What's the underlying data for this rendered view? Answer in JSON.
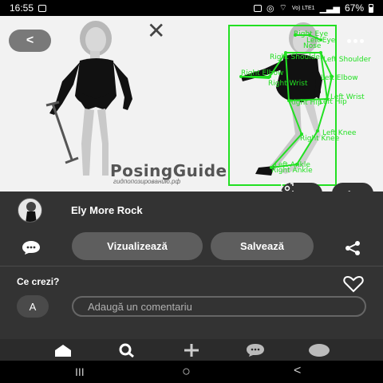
{
  "status_bar": {
    "time": "16:55",
    "network": "Vo) LTE1",
    "battery": "67%"
  },
  "pin_image": {
    "watermark": "PosingGuide",
    "watermark_sub": "гидпопозированию.рф",
    "pose_labels": [
      "Right Eye",
      "Left Eye",
      "Nose",
      "Right Shoulder",
      "Left Shoulder",
      "Right Elbow",
      "Left Elbow",
      "Right Wrist",
      "Left Wrist",
      "Right Hip",
      "Left Hip",
      "Left Knee",
      "Right Knee",
      "Left Ankle",
      "Right Ankle"
    ],
    "overlay_color": "#22e022"
  },
  "creator": {
    "name": "Ely More Rock"
  },
  "actions": {
    "visit_label": "Vizualizează",
    "save_label": "Salvează"
  },
  "comments": {
    "title": "Ce crezi?",
    "avatar_initial": "A",
    "input_placeholder": "Adaugă un comentariu"
  },
  "bottom_nav": {
    "items": [
      "home-icon",
      "search-icon",
      "add-icon",
      "messages-icon",
      "profile-icon"
    ]
  },
  "system_nav": {
    "recents": "III",
    "home": "○",
    "back": "<"
  }
}
